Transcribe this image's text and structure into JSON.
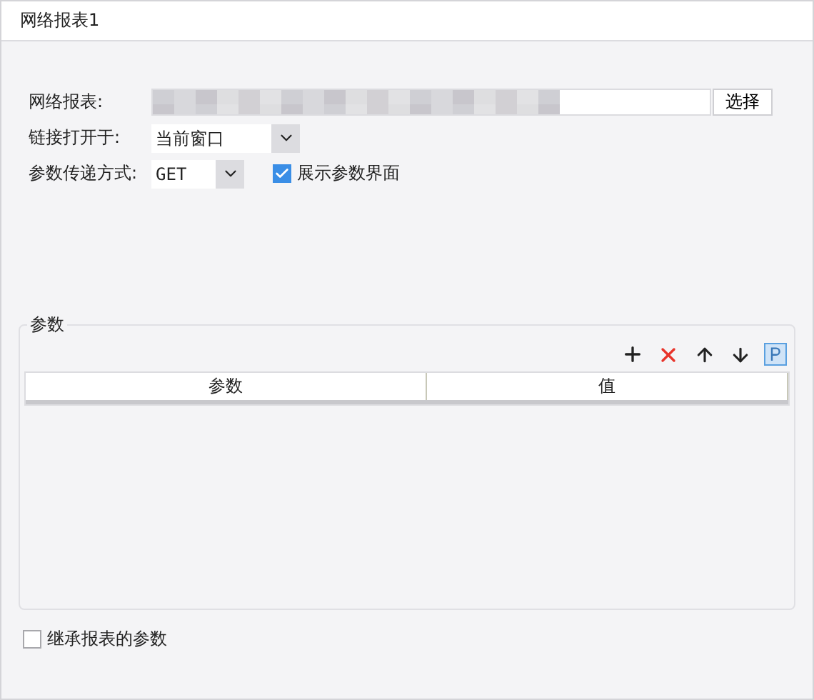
{
  "window": {
    "title": "网络报表1"
  },
  "form": {
    "report_label": "网络报表:",
    "choose_button": "选择",
    "open_label": "链接打开于:",
    "open_value": "当前窗口",
    "method_label": "参数传递方式:",
    "method_value": "GET",
    "show_params": {
      "label": "展示参数界面",
      "checked": true
    }
  },
  "params": {
    "title": "参数",
    "table": {
      "columns": [
        "参数",
        "值"
      ]
    }
  },
  "inherit": {
    "label": "继承报表的参数",
    "checked": false
  }
}
